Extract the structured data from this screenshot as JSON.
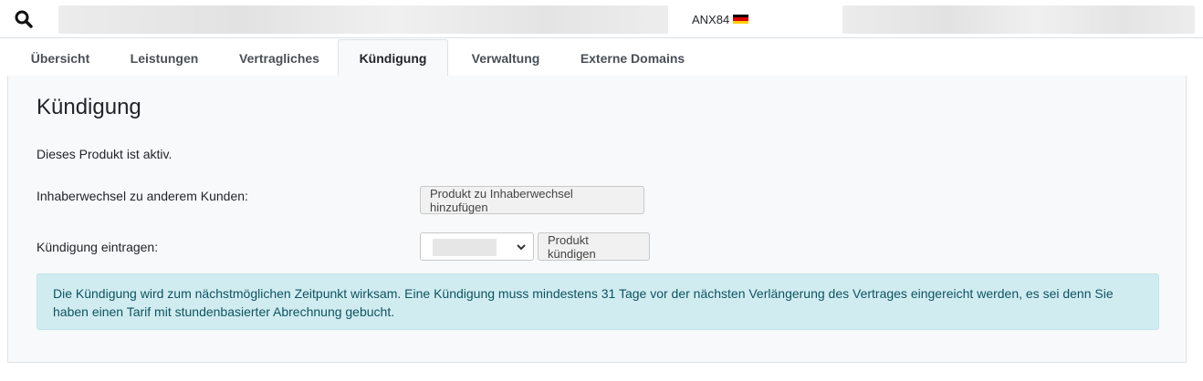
{
  "topbar": {
    "search_icon": "search-icon",
    "server_label": "ANX84",
    "flag": "germany-flag-icon"
  },
  "tabs": [
    {
      "label": "Übersicht",
      "active": false
    },
    {
      "label": "Leistungen",
      "active": false
    },
    {
      "label": "Vertragliches",
      "active": false
    },
    {
      "label": "Kündigung",
      "active": true
    },
    {
      "label": "Verwaltung",
      "active": false
    },
    {
      "label": "Externe Domains",
      "active": false
    }
  ],
  "panel": {
    "title": "Kündigung",
    "status_text": "Dieses Produkt ist aktiv.",
    "owner_change_label": "Inhaberwechsel zu anderem Kunden:",
    "owner_change_button": "Produkt zu Inhaberwechsel hinzufügen",
    "cancel_label": "Kündigung eintragen:",
    "cancel_button": "Produkt kündigen",
    "alert_text": "Die Kündigung wird zum nächstmöglichen Zeitpunkt wirksam. Eine Kündigung muss mindestens 31 Tage vor der nächsten Verlängerung des Vertrages eingereicht werden, es sei denn Sie haben einen Tarif mit stundenbasierter Abrechnung gebucht."
  },
  "colors": {
    "alert_bg": "#d1ecf1",
    "alert_text": "#0c5460",
    "panel_bg": "#f8f9fa"
  }
}
